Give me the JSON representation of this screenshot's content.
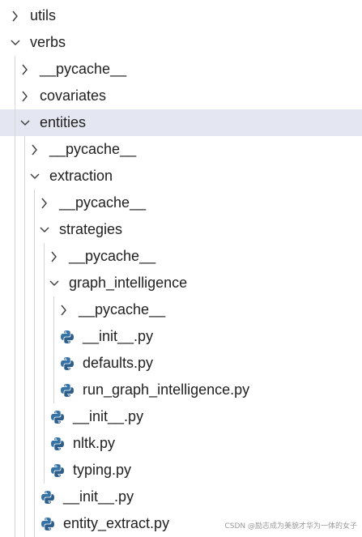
{
  "explorer": {
    "items": [
      {
        "label": "utils",
        "kind": "folder",
        "state": "collapsed",
        "depth": 0
      },
      {
        "label": "verbs",
        "kind": "folder",
        "state": "expanded",
        "depth": 0
      },
      {
        "label": "__pycache__",
        "kind": "folder",
        "state": "collapsed",
        "depth": 1
      },
      {
        "label": "covariates",
        "kind": "folder",
        "state": "collapsed",
        "depth": 1
      },
      {
        "label": "entities",
        "kind": "folder",
        "state": "expanded",
        "depth": 1,
        "selected": true
      },
      {
        "label": "__pycache__",
        "kind": "folder",
        "state": "collapsed",
        "depth": 2
      },
      {
        "label": "extraction",
        "kind": "folder",
        "state": "expanded",
        "depth": 2
      },
      {
        "label": "__pycache__",
        "kind": "folder",
        "state": "collapsed",
        "depth": 3
      },
      {
        "label": "strategies",
        "kind": "folder",
        "state": "expanded",
        "depth": 3
      },
      {
        "label": "__pycache__",
        "kind": "folder",
        "state": "collapsed",
        "depth": 4
      },
      {
        "label": "graph_intelligence",
        "kind": "folder",
        "state": "expanded",
        "depth": 4
      },
      {
        "label": "__pycache__",
        "kind": "folder",
        "state": "collapsed",
        "depth": 5
      },
      {
        "label": "__init__.py",
        "kind": "python",
        "depth": 5
      },
      {
        "label": "defaults.py",
        "kind": "python",
        "depth": 5
      },
      {
        "label": "run_graph_intelligence.py",
        "kind": "python",
        "depth": 5
      },
      {
        "label": "__init__.py",
        "kind": "python",
        "depth": 4
      },
      {
        "label": "nltk.py",
        "kind": "python",
        "depth": 4
      },
      {
        "label": "typing.py",
        "kind": "python",
        "depth": 4
      },
      {
        "label": "__init__.py",
        "kind": "python",
        "depth": 3
      },
      {
        "label": "entity_extract.py",
        "kind": "python",
        "depth": 3
      }
    ]
  },
  "watermark": "CSDN @励志成为美貌才华为一体的女子",
  "colors": {
    "selected_row": "#e4e6f1",
    "python_blue": "#3572a5",
    "python_dark": "#2d5f8a",
    "text": "#1f1f1f",
    "guide": "#d6d6d6"
  }
}
